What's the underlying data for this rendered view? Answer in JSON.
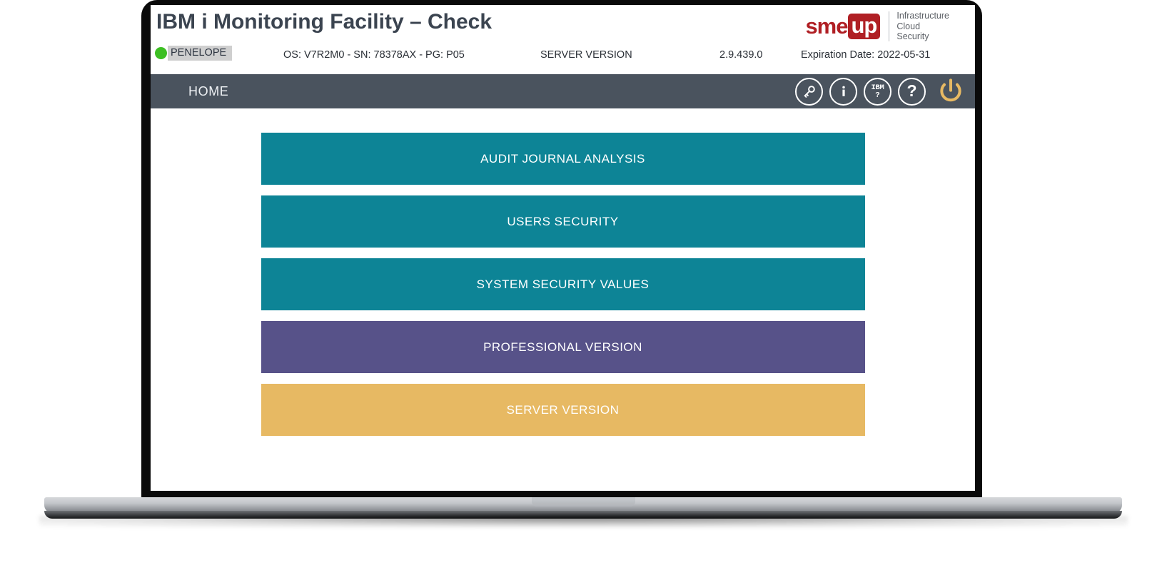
{
  "header": {
    "app_title": "IBM i Monitoring Facility – Check",
    "system_name": "PENELOPE",
    "status_dot_color": "#3dbf23",
    "os_info": "OS: V7R2M0 - SN: 78378AX - PG: P05",
    "server_version_label": "SERVER VERSION",
    "server_version_value": "2.9.439.0",
    "expiration": "Expiration Date: 2022-05-31",
    "brand": {
      "name_left": "sme",
      "name_right": "up",
      "tagline_line1": "Infrastructure",
      "tagline_line2": "Cloud",
      "tagline_line3": "Security",
      "color": "#b01f24"
    }
  },
  "navbar": {
    "home_label": "HOME",
    "background": "#4a535e",
    "actions": [
      {
        "name": "key-icon",
        "label": ""
      },
      {
        "name": "info-icon",
        "label": "i"
      },
      {
        "name": "ibm-help-icon",
        "label_top": "IBM",
        "label_bottom": "?"
      },
      {
        "name": "help-icon",
        "label": "?"
      }
    ],
    "power_label": "",
    "power_color": "#e7b963"
  },
  "main": {
    "menu_items": [
      {
        "label": "AUDIT JOURNAL ANALYSIS",
        "color": "#0d8496",
        "style": "teal"
      },
      {
        "label": "USERS SECURITY",
        "color": "#0d8496",
        "style": "teal"
      },
      {
        "label": "SYSTEM SECURITY VALUES",
        "color": "#0d8496",
        "style": "teal"
      },
      {
        "label": "PROFESSIONAL VERSION",
        "color": "#575289",
        "style": "purple"
      },
      {
        "label": "SERVER VERSION",
        "color": "#e7b963",
        "style": "amber"
      }
    ]
  }
}
